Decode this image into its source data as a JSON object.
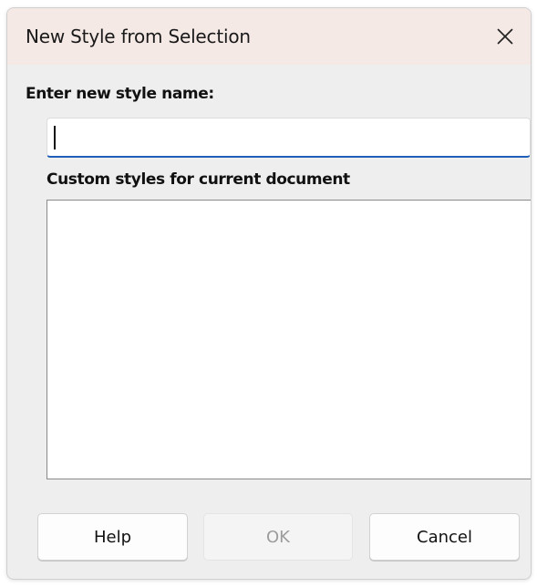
{
  "dialog": {
    "title": "New Style from Selection",
    "close_icon": "close-icon"
  },
  "name_section": {
    "label": "Enter new style name:",
    "value": ""
  },
  "styles_section": {
    "label": "Custom styles for current document",
    "items": []
  },
  "buttons": {
    "help_label": "Help",
    "ok_label": "OK",
    "ok_enabled": false,
    "cancel_label": "Cancel"
  },
  "colors": {
    "titlebar": "#f5e9e6",
    "dialog_background": "#eeeeee",
    "input_focus_underline": "#1f5fb8",
    "disabled_text": "#9c9c9c"
  }
}
